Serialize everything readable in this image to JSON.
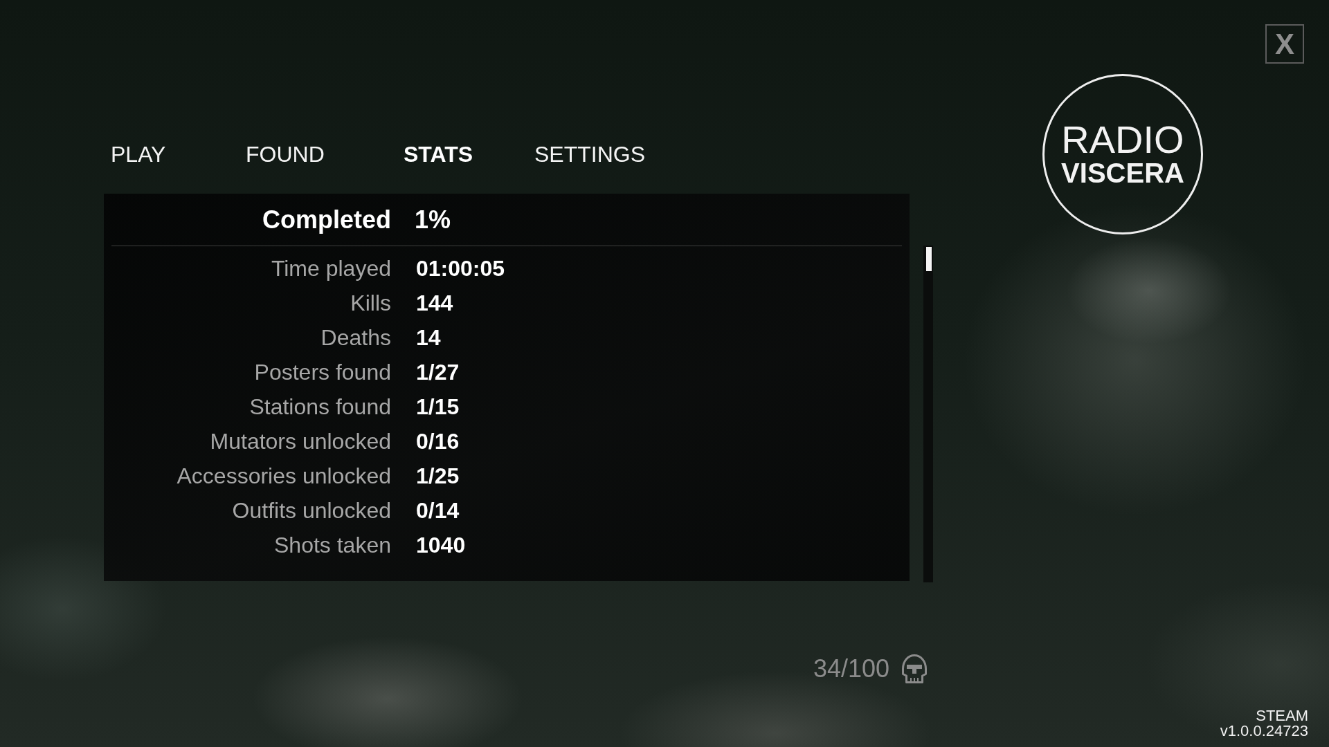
{
  "close_button": {
    "label": "X"
  },
  "logo": {
    "line_1": "RADIO",
    "line_2": "VISCERA"
  },
  "tabs": [
    {
      "label": "PLAY",
      "selected": false
    },
    {
      "label": "FOUND",
      "selected": false
    },
    {
      "label": "STATS",
      "selected": true
    },
    {
      "label": "SETTINGS",
      "selected": false
    }
  ],
  "stats": {
    "header": {
      "label": "Completed",
      "value": "1%"
    },
    "rows": [
      {
        "label": "Time played",
        "value": "01:00:05"
      },
      {
        "label": "Kills",
        "value": "144"
      },
      {
        "label": "Deaths",
        "value": "14"
      },
      {
        "label": "Posters found",
        "value": "1/27"
      },
      {
        "label": "Stations found",
        "value": "1/15"
      },
      {
        "label": "Mutators unlocked",
        "value": "0/16"
      },
      {
        "label": "Accessories unlocked",
        "value": "1/25"
      },
      {
        "label": "Outfits unlocked",
        "value": "0/14"
      },
      {
        "label": "Shots taken",
        "value": "1040"
      }
    ]
  },
  "collectibles": {
    "count": "34/100"
  },
  "footer": {
    "platform": "STEAM",
    "version": "v1.0.0.24723"
  }
}
